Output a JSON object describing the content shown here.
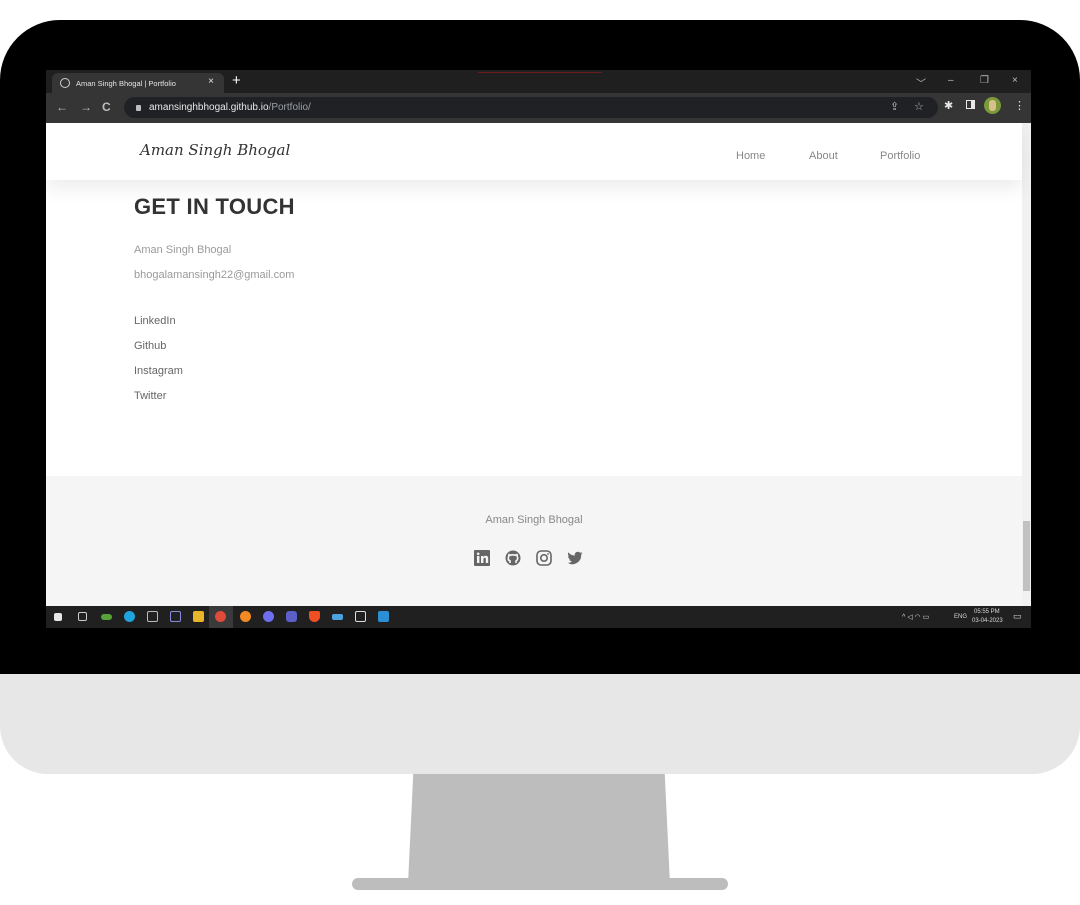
{
  "browser": {
    "tab_title": "Aman Singh Bhogal | Portfolio",
    "tab_close": "×",
    "new_tab": "+",
    "url_host": "amansinghbhogal.github.io",
    "url_path": "/Portfolio/",
    "window_controls": [
      "﹀",
      "–",
      "❐",
      "×"
    ]
  },
  "site": {
    "logo": "Aman Singh Bhogal",
    "nav": [
      "Home",
      "About",
      "Portfolio"
    ]
  },
  "contact": {
    "heading": "GET IN TOUCH",
    "name": "Aman Singh Bhogal",
    "email": "bhogalamansingh22@gmail.com",
    "links": [
      "LinkedIn",
      "Github",
      "Instagram",
      "Twitter"
    ]
  },
  "footer": {
    "name": "Aman Singh Bhogal",
    "social_icons": [
      "linkedin-icon",
      "github-icon",
      "instagram-icon",
      "twitter-icon"
    ]
  },
  "taskbar": {
    "language": "ENG",
    "time": "05:55 PM",
    "date": "03-04-2023"
  }
}
